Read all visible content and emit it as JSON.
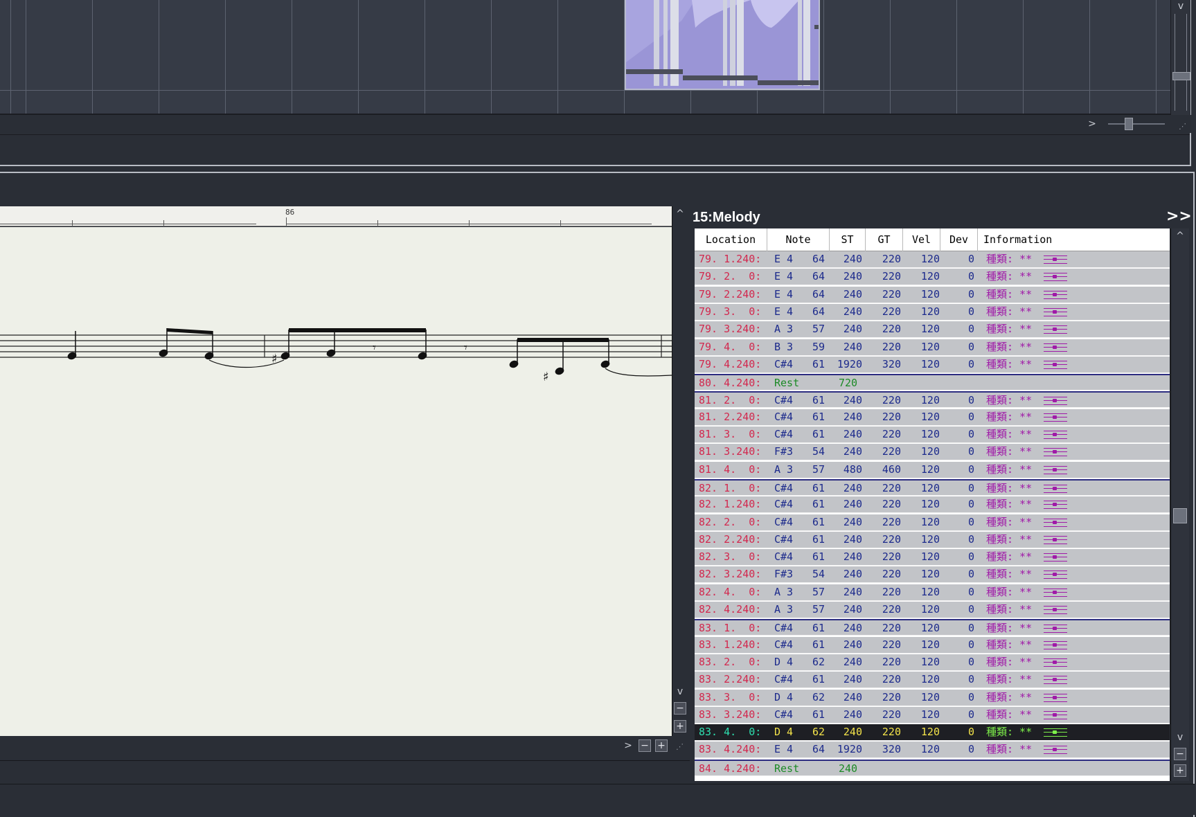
{
  "score": {
    "measure_label": "86"
  },
  "list": {
    "title": "15:Melody",
    "expand_label": ">>",
    "columns": [
      "Location",
      "Note",
      "ST",
      "GT",
      "Vel",
      "Dev",
      "Information"
    ],
    "rows": [
      {
        "loc": "79. 1.240:",
        "note": "E 4",
        "num": "64",
        "st": "240",
        "gt": "220",
        "vel": "120",
        "dev": "0",
        "info": "種類: **"
      },
      {
        "loc": "79. 2.  0:",
        "note": "E 4",
        "num": "64",
        "st": "240",
        "gt": "220",
        "vel": "120",
        "dev": "0",
        "info": "種類: **"
      },
      {
        "loc": "79. 2.240:",
        "note": "E 4",
        "num": "64",
        "st": "240",
        "gt": "220",
        "vel": "120",
        "dev": "0",
        "info": "種類: **"
      },
      {
        "loc": "79. 3.  0:",
        "note": "E 4",
        "num": "64",
        "st": "240",
        "gt": "220",
        "vel": "120",
        "dev": "0",
        "info": "種類: **"
      },
      {
        "loc": "79. 3.240:",
        "note": "A 3",
        "num": "57",
        "st": "240",
        "gt": "220",
        "vel": "120",
        "dev": "0",
        "info": "種類: **"
      },
      {
        "loc": "79. 4.  0:",
        "note": "B 3",
        "num": "59",
        "st": "240",
        "gt": "220",
        "vel": "120",
        "dev": "0",
        "info": "種類: **"
      },
      {
        "loc": "79. 4.240:",
        "note": "C#4",
        "num": "61",
        "st": "1920",
        "gt": "320",
        "vel": "120",
        "dev": "0",
        "info": "種類: **"
      },
      {
        "loc": "80. 4.240:",
        "rest": "Rest",
        "st": "720",
        "type": "rest",
        "barline": true
      },
      {
        "loc": "81. 2.  0:",
        "note": "C#4",
        "num": "61",
        "st": "240",
        "gt": "220",
        "vel": "120",
        "dev": "0",
        "info": "種類: **",
        "barline": true
      },
      {
        "loc": "81. 2.240:",
        "note": "C#4",
        "num": "61",
        "st": "240",
        "gt": "220",
        "vel": "120",
        "dev": "0",
        "info": "種類: **"
      },
      {
        "loc": "81. 3.  0:",
        "note": "C#4",
        "num": "61",
        "st": "240",
        "gt": "220",
        "vel": "120",
        "dev": "0",
        "info": "種類: **"
      },
      {
        "loc": "81. 3.240:",
        "note": "F#3",
        "num": "54",
        "st": "240",
        "gt": "220",
        "vel": "120",
        "dev": "0",
        "info": "種類: **"
      },
      {
        "loc": "81. 4.  0:",
        "note": "A 3",
        "num": "57",
        "st": "480",
        "gt": "460",
        "vel": "120",
        "dev": "0",
        "info": "種類: **"
      },
      {
        "loc": "82. 1.  0:",
        "note": "C#4",
        "num": "61",
        "st": "240",
        "gt": "220",
        "vel": "120",
        "dev": "0",
        "info": "種類: **",
        "barline": true
      },
      {
        "loc": "82. 1.240:",
        "note": "C#4",
        "num": "61",
        "st": "240",
        "gt": "220",
        "vel": "120",
        "dev": "0",
        "info": "種類: **"
      },
      {
        "loc": "82. 2.  0:",
        "note": "C#4",
        "num": "61",
        "st": "240",
        "gt": "220",
        "vel": "120",
        "dev": "0",
        "info": "種類: **"
      },
      {
        "loc": "82. 2.240:",
        "note": "C#4",
        "num": "61",
        "st": "240",
        "gt": "220",
        "vel": "120",
        "dev": "0",
        "info": "種類: **"
      },
      {
        "loc": "82. 3.  0:",
        "note": "C#4",
        "num": "61",
        "st": "240",
        "gt": "220",
        "vel": "120",
        "dev": "0",
        "info": "種類: **"
      },
      {
        "loc": "82. 3.240:",
        "note": "F#3",
        "num": "54",
        "st": "240",
        "gt": "220",
        "vel": "120",
        "dev": "0",
        "info": "種類: **"
      },
      {
        "loc": "82. 4.  0:",
        "note": "A 3",
        "num": "57",
        "st": "240",
        "gt": "220",
        "vel": "120",
        "dev": "0",
        "info": "種類: **"
      },
      {
        "loc": "82. 4.240:",
        "note": "A 3",
        "num": "57",
        "st": "240",
        "gt": "220",
        "vel": "120",
        "dev": "0",
        "info": "種類: **"
      },
      {
        "loc": "83. 1.  0:",
        "note": "C#4",
        "num": "61",
        "st": "240",
        "gt": "220",
        "vel": "120",
        "dev": "0",
        "info": "種類: **",
        "barline": true
      },
      {
        "loc": "83. 1.240:",
        "note": "C#4",
        "num": "61",
        "st": "240",
        "gt": "220",
        "vel": "120",
        "dev": "0",
        "info": "種類: **"
      },
      {
        "loc": "83. 2.  0:",
        "note": "D 4",
        "num": "62",
        "st": "240",
        "gt": "220",
        "vel": "120",
        "dev": "0",
        "info": "種類: **"
      },
      {
        "loc": "83. 2.240:",
        "note": "C#4",
        "num": "61",
        "st": "240",
        "gt": "220",
        "vel": "120",
        "dev": "0",
        "info": "種類: **"
      },
      {
        "loc": "83. 3.  0:",
        "note": "D 4",
        "num": "62",
        "st": "240",
        "gt": "220",
        "vel": "120",
        "dev": "0",
        "info": "種類: **"
      },
      {
        "loc": "83. 3.240:",
        "note": "C#4",
        "num": "61",
        "st": "240",
        "gt": "220",
        "vel": "120",
        "dev": "0",
        "info": "種類: **"
      },
      {
        "loc": "83. 4.  0:",
        "note": "D 4",
        "num": "62",
        "st": "240",
        "gt": "220",
        "vel": "120",
        "dev": "0",
        "info": "種類: **",
        "current": true
      },
      {
        "loc": "83. 4.240:",
        "note": "E 4",
        "num": "64",
        "st": "1920",
        "gt": "320",
        "vel": "120",
        "dev": "0",
        "info": "種類: **"
      },
      {
        "loc": "84. 4.240:",
        "rest": "Rest",
        "st": "240",
        "type": "rest",
        "barline": true
      }
    ]
  },
  "scroll": {
    "right_label": ">",
    "up_label": "^",
    "down_label": "v",
    "zoom_out_label": "−",
    "zoom_in_label": "+"
  },
  "colors": {
    "location": "#d2284e",
    "values": "#1c2a8c",
    "info": "#a01aa8",
    "rest": "#1c8a26",
    "current_row_bg": "#1e1f24"
  }
}
